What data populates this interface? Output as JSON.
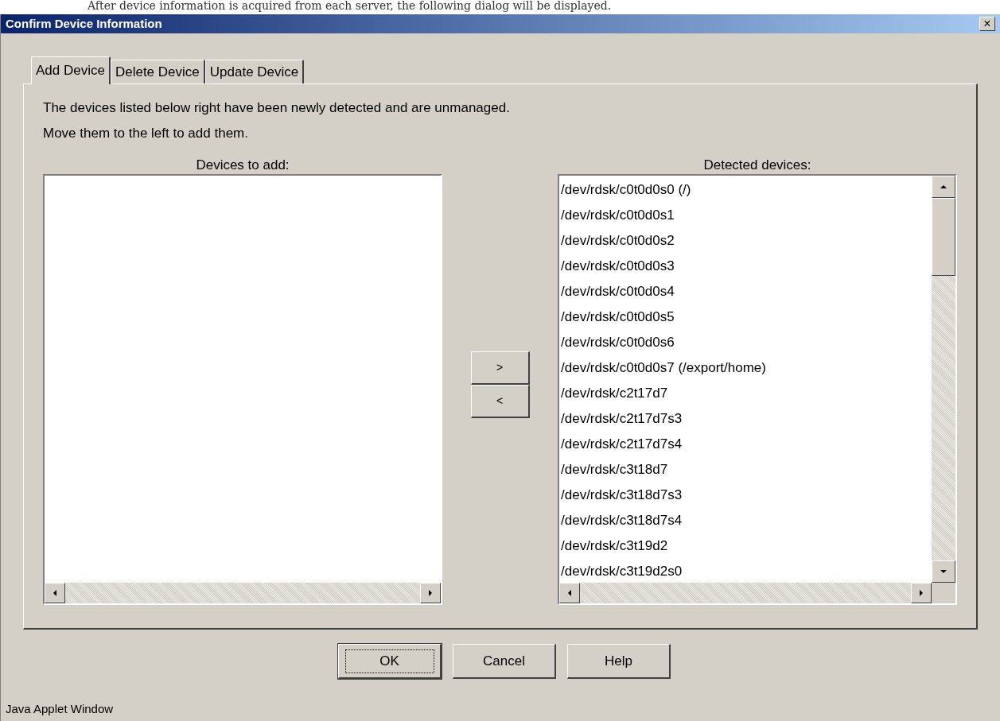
{
  "caption": "After device information is acquired from each server, the following dialog will be displayed.",
  "window": {
    "title": "Confirm Device Information",
    "close": "×"
  },
  "tabs": [
    {
      "label": "Add Device",
      "selected": true
    },
    {
      "label": "Delete Device",
      "selected": false
    },
    {
      "label": "Update Device",
      "selected": false
    }
  ],
  "description": [
    "The devices listed below right have been newly detected and are unmanaged.",
    "Move them to the left to add them."
  ],
  "left_list": {
    "label": "Devices to add:"
  },
  "move_buttons": [
    ">",
    "<"
  ],
  "right_list": {
    "label": "Detected devices:",
    "items": [
      "/dev/rdsk/c0t0d0s0 (/)",
      "/dev/rdsk/c0t0d0s1",
      "/dev/rdsk/c0t0d0s2",
      "/dev/rdsk/c0t0d0s3",
      "/dev/rdsk/c0t0d0s4",
      "/dev/rdsk/c0t0d0s5",
      "/dev/rdsk/c0t0d0s6",
      "/dev/rdsk/c0t0d0s7 (/export/home)",
      "/dev/rdsk/c2t17d7",
      "/dev/rdsk/c2t17d7s3",
      "/dev/rdsk/c2t17d7s4",
      "/dev/rdsk/c3t18d7",
      "/dev/rdsk/c3t18d7s3",
      "/dev/rdsk/c3t18d7s4",
      "/dev/rdsk/c3t19d2",
      "/dev/rdsk/c3t19d2s0"
    ]
  },
  "buttons": [
    {
      "label": "OK",
      "focused": true
    },
    {
      "label": "Cancel",
      "focused": false
    },
    {
      "label": "Help",
      "focused": false
    }
  ],
  "status_bar": "Java Applet Window"
}
